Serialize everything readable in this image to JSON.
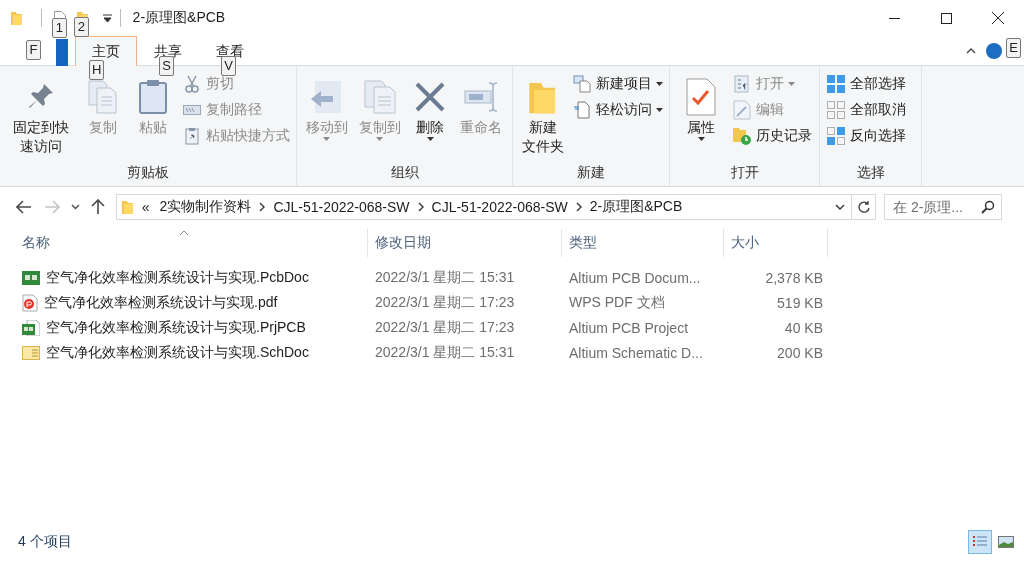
{
  "window": {
    "title": "2-原理图&PCB",
    "quick_access": [
      {
        "kind": "folder"
      },
      {
        "kind": "file",
        "keytip": "1"
      },
      {
        "kind": "folder",
        "keytip": "2"
      }
    ]
  },
  "ribbon": {
    "file_tab": {
      "keytip": "F"
    },
    "tabs": [
      {
        "label": "主页",
        "keytip": "H",
        "selected": true
      },
      {
        "label": "共享",
        "keytip": "S",
        "selected": false
      },
      {
        "label": "查看",
        "keytip": "V",
        "selected": false
      }
    ],
    "help": {
      "keytip": "E"
    },
    "groups": [
      {
        "label": "剪贴板",
        "items": [
          {
            "kind": "large",
            "lines": [
              "固定到快",
              "速访问"
            ],
            "disabled": false,
            "caret": false
          },
          {
            "kind": "large",
            "label": "复制",
            "disabled": true,
            "caret": false
          },
          {
            "kind": "large",
            "label": "粘贴",
            "disabled": true,
            "caret": false
          },
          {
            "kind": "small",
            "label": "剪切",
            "disabled": true,
            "caret": false
          },
          {
            "kind": "small",
            "label": "复制路径",
            "disabled": true,
            "caret": false
          },
          {
            "kind": "small",
            "label": "粘贴快捷方式",
            "disabled": true,
            "caret": false
          }
        ]
      },
      {
        "label": "组织",
        "items": [
          {
            "kind": "large",
            "label": "移动到",
            "disabled": true,
            "caret": true
          },
          {
            "kind": "large",
            "label": "复制到",
            "disabled": true,
            "caret": true
          },
          {
            "kind": "large",
            "label": "删除",
            "disabled": false,
            "caret": true
          },
          {
            "kind": "large",
            "label": "重命名",
            "disabled": true,
            "caret": false
          }
        ]
      },
      {
        "label": "新建",
        "items": [
          {
            "kind": "large",
            "lines": [
              "新建",
              "文件夹"
            ],
            "disabled": false,
            "caret": false
          },
          {
            "kind": "small",
            "label": "新建项目",
            "disabled": false,
            "caret": true
          },
          {
            "kind": "small",
            "label": "轻松访问",
            "disabled": false,
            "caret": true
          }
        ]
      },
      {
        "label": "打开",
        "items": [
          {
            "kind": "large",
            "label": "属性",
            "disabled": false,
            "caret": true
          },
          {
            "kind": "small",
            "label": "打开",
            "disabled": true,
            "caret": true
          },
          {
            "kind": "small",
            "label": "编辑",
            "disabled": true,
            "caret": false
          },
          {
            "kind": "small",
            "label": "历史记录",
            "disabled": false,
            "caret": false
          }
        ]
      },
      {
        "label": "选择",
        "items": [
          {
            "kind": "small",
            "label": "全部选择",
            "disabled": false,
            "caret": false
          },
          {
            "kind": "small",
            "label": "全部取消",
            "disabled": false,
            "caret": false
          },
          {
            "kind": "small",
            "label": "反向选择",
            "disabled": false,
            "caret": false
          }
        ]
      }
    ]
  },
  "navigation": [
    {
      "kind": "back",
      "disabled": false
    },
    {
      "kind": "forward",
      "disabled": true
    },
    {
      "kind": "recent",
      "disabled": false
    },
    {
      "kind": "up",
      "disabled": false
    }
  ],
  "address": {
    "overflow": "«",
    "crumbs": [
      "2实物制作资料",
      "CJL-51-2022-068-SW",
      "CJL-51-2022-068-SW",
      "2-原理图&PCB"
    ]
  },
  "search": {
    "placeholder": "在 2-原理..."
  },
  "columns": [
    {
      "label": "名称",
      "sorted": true
    },
    {
      "label": "修改日期",
      "sorted": false
    },
    {
      "label": "类型",
      "sorted": false
    },
    {
      "label": "大小",
      "sorted": false
    }
  ],
  "rows": [
    {
      "kind": "pcb",
      "name": "空气净化效率检测系统设计与实现.PcbDoc",
      "modified": "2022/3/1 星期二 15:31",
      "type": "Altium PCB Docum...",
      "size": "2,378 KB"
    },
    {
      "kind": "pdf",
      "name": "空气净化效率检测系统设计与实现.pdf",
      "modified": "2022/3/1 星期二 17:23",
      "type": "WPS PDF 文档",
      "size": "519 KB"
    },
    {
      "kind": "project",
      "name": "空气净化效率检测系统设计与实现.PrjPCB",
      "modified": "2022/3/1 星期二 17:23",
      "type": "Altium PCB Project",
      "size": "40 KB"
    },
    {
      "kind": "schematic",
      "name": "空气净化效率检测系统设计与实现.SchDoc",
      "modified": "2022/3/1 星期二 15:31",
      "type": "Altium Schematic D...",
      "size": "200 KB"
    }
  ],
  "status_bar": {
    "count": "4 个项目",
    "views": [
      {
        "kind": "details",
        "selected": true
      },
      {
        "kind": "large_icons",
        "selected": false
      }
    ]
  }
}
